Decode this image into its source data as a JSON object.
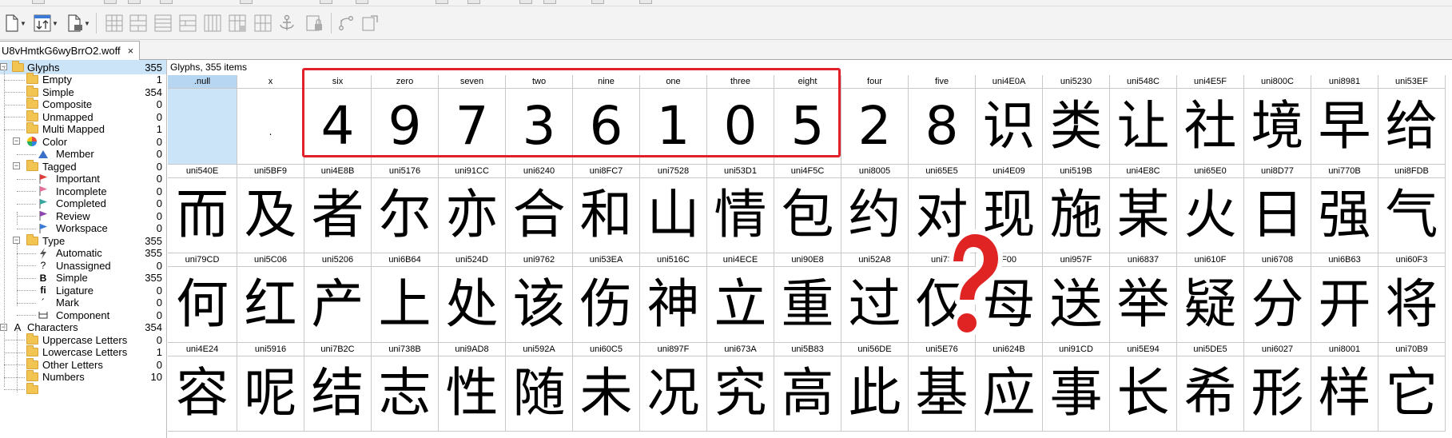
{
  "document_tab": {
    "title": "U8vHmtkG6wyBrrO2.woff",
    "close_glyph": "×"
  },
  "toolbar": {
    "icons": [
      "new-file-icon",
      "sort-icon",
      "export-file-icon",
      "grid-view-icon",
      "merge-icon",
      "anchor-icon",
      "metrics-icon",
      "flip-icon"
    ]
  },
  "colors": {
    "selection": "#cce4f7",
    "highlight": "#e0202a",
    "folder": "#f2c553"
  },
  "sidebar": {
    "items": [
      {
        "label": "Glyphs",
        "count": "355",
        "icon": "folder",
        "level": 0,
        "expander": "minus",
        "selected": true
      },
      {
        "label": "Empty",
        "count": "1",
        "icon": "folder",
        "level": 1
      },
      {
        "label": "Simple",
        "count": "354",
        "icon": "folder",
        "level": 1
      },
      {
        "label": "Composite",
        "count": "0",
        "icon": "folder",
        "level": 1
      },
      {
        "label": "Unmapped",
        "count": "0",
        "icon": "folder",
        "level": 1
      },
      {
        "label": "Multi Mapped",
        "count": "1",
        "icon": "folder",
        "level": 1
      },
      {
        "label": "Color",
        "count": "0",
        "icon": "color",
        "level": 1,
        "expander": "minus"
      },
      {
        "label": "Member",
        "count": "0",
        "icon": "member",
        "level": 2
      },
      {
        "label": "Tagged",
        "count": "0",
        "icon": "folder",
        "level": 1,
        "expander": "minus"
      },
      {
        "label": "Important",
        "count": "0",
        "icon": "flag-red",
        "level": 2
      },
      {
        "label": "Incomplete",
        "count": "0",
        "icon": "flag-pink",
        "level": 2
      },
      {
        "label": "Completed",
        "count": "0",
        "icon": "flag-teal",
        "level": 2
      },
      {
        "label": "Review",
        "count": "0",
        "icon": "flag-purple",
        "level": 2
      },
      {
        "label": "Workspace",
        "count": "0",
        "icon": "flag-blue",
        "level": 2
      },
      {
        "label": "Type",
        "count": "355",
        "icon": "folder",
        "level": 1,
        "expander": "minus"
      },
      {
        "label": "Automatic",
        "count": "355",
        "icon": "bolt",
        "level": 2
      },
      {
        "label": "Unassigned",
        "count": "0",
        "icon": "?",
        "level": 2
      },
      {
        "label": "Simple",
        "count": "355",
        "icon": "B",
        "level": 2
      },
      {
        "label": "Ligature",
        "count": "0",
        "icon": "fi",
        "level": 2
      },
      {
        "label": "Mark",
        "count": "0",
        "icon": "´",
        "level": 2
      },
      {
        "label": "Component",
        "count": "0",
        "icon": "component",
        "level": 2
      },
      {
        "label": "Characters",
        "count": "354",
        "icon": "A",
        "level": 0,
        "expander": "minus"
      },
      {
        "label": "Uppercase Letters",
        "count": "0",
        "icon": "folder",
        "level": 1
      },
      {
        "label": "Lowercase Letters",
        "count": "1",
        "icon": "folder",
        "level": 1
      },
      {
        "label": "Other Letters",
        "count": "0",
        "icon": "folder",
        "level": 1
      },
      {
        "label": "Numbers",
        "count": "10",
        "icon": "folder",
        "level": 1
      },
      {
        "label": "",
        "count": "",
        "icon": "folder",
        "level": 1
      }
    ]
  },
  "grid": {
    "header": "Glyphs, 355 items",
    "rows": [
      [
        {
          "name": ".null",
          "glyph": "",
          "selected": true
        },
        {
          "name": "x",
          "glyph": "."
        },
        {
          "name": "six",
          "glyph": "4"
        },
        {
          "name": "zero",
          "glyph": "9"
        },
        {
          "name": "seven",
          "glyph": "7"
        },
        {
          "name": "two",
          "glyph": "3"
        },
        {
          "name": "nine",
          "glyph": "6"
        },
        {
          "name": "one",
          "glyph": "1"
        },
        {
          "name": "three",
          "glyph": "0"
        },
        {
          "name": "eight",
          "glyph": "5"
        },
        {
          "name": "four",
          "glyph": "2"
        },
        {
          "name": "five",
          "glyph": "8"
        },
        {
          "name": "uni4E0A",
          "glyph": "识"
        },
        {
          "name": "uni5230",
          "glyph": "类"
        },
        {
          "name": "uni548C",
          "glyph": "让"
        },
        {
          "name": "uni4E5F",
          "glyph": "社"
        },
        {
          "name": "uni800C",
          "glyph": "境"
        },
        {
          "name": "uni8981",
          "glyph": "早"
        },
        {
          "name": "uni53EF",
          "glyph": "给"
        }
      ],
      [
        {
          "name": "uni540E",
          "glyph": "而"
        },
        {
          "name": "uni5BF9",
          "glyph": "及"
        },
        {
          "name": "uni4E8B",
          "glyph": "者"
        },
        {
          "name": "uni5176",
          "glyph": "尔"
        },
        {
          "name": "uni91CC",
          "glyph": "亦"
        },
        {
          "name": "uni6240",
          "glyph": "合"
        },
        {
          "name": "uni8FC7",
          "glyph": "和"
        },
        {
          "name": "uni7528",
          "glyph": "山"
        },
        {
          "name": "uni53D1",
          "glyph": "情"
        },
        {
          "name": "uni4F5C",
          "glyph": "包"
        },
        {
          "name": "uni8005",
          "glyph": "约"
        },
        {
          "name": "uni65E5",
          "glyph": "对"
        },
        {
          "name": "uni4E09",
          "glyph": "现"
        },
        {
          "name": "uni519B",
          "glyph": "施"
        },
        {
          "name": "uni4E8C",
          "glyph": "某"
        },
        {
          "name": "uni65E0",
          "glyph": "火"
        },
        {
          "name": "uni8D77",
          "glyph": "日"
        },
        {
          "name": "uni770B",
          "glyph": "强"
        },
        {
          "name": "uni8FDB",
          "glyph": "气"
        }
      ],
      [
        {
          "name": "uni79CD",
          "glyph": "何"
        },
        {
          "name": "uni5C06",
          "glyph": "红"
        },
        {
          "name": "uni5206",
          "glyph": "产"
        },
        {
          "name": "uni6B64",
          "glyph": "上"
        },
        {
          "name": "uni524D",
          "glyph": "处"
        },
        {
          "name": "uni9762",
          "glyph": "该"
        },
        {
          "name": "uni53EA",
          "glyph": "伤"
        },
        {
          "name": "uni516C",
          "glyph": "神"
        },
        {
          "name": "uni4ECE",
          "glyph": "立"
        },
        {
          "name": "uni90E8",
          "glyph": "重"
        },
        {
          "name": "uni52A8",
          "glyph": "过"
        },
        {
          "name": "uni73",
          "glyph": "仅"
        },
        {
          "name": "F00",
          "glyph": "母"
        },
        {
          "name": "uni957F",
          "glyph": "送"
        },
        {
          "name": "uni6837",
          "glyph": "举"
        },
        {
          "name": "uni610F",
          "glyph": "疑"
        },
        {
          "name": "uni6708",
          "glyph": "分"
        },
        {
          "name": "uni6B63",
          "glyph": "开"
        },
        {
          "name": "uni60F3",
          "glyph": "将"
        }
      ],
      [
        {
          "name": "uni4E24",
          "glyph": "容"
        },
        {
          "name": "uni5916",
          "glyph": "呢"
        },
        {
          "name": "uni7B2C",
          "glyph": "结"
        },
        {
          "name": "uni738B",
          "glyph": "志"
        },
        {
          "name": "uni9AD8",
          "glyph": "性"
        },
        {
          "name": "uni592A",
          "glyph": "随"
        },
        {
          "name": "uni60C5",
          "glyph": "未"
        },
        {
          "name": "uni897F",
          "glyph": "况"
        },
        {
          "name": "uni673A",
          "glyph": "究"
        },
        {
          "name": "uni5B83",
          "glyph": "高"
        },
        {
          "name": "uni56DE",
          "glyph": "此"
        },
        {
          "name": "uni5E76",
          "glyph": "基"
        },
        {
          "name": "uni624B",
          "glyph": "应"
        },
        {
          "name": "uni91CD",
          "glyph": "事"
        },
        {
          "name": "uni5E94",
          "glyph": "长"
        },
        {
          "name": "uni5DE5",
          "glyph": "希"
        },
        {
          "name": "uni6027",
          "glyph": "形"
        },
        {
          "name": "uni8001",
          "glyph": "样"
        },
        {
          "name": "uni70B9",
          "glyph": "它"
        }
      ]
    ]
  },
  "annotations": {
    "highlighted_glyphs": [
      "six",
      "zero",
      "seven",
      "two",
      "nine",
      "one",
      "three",
      "eight"
    ],
    "overlay_icon": "question-mark-icon"
  }
}
